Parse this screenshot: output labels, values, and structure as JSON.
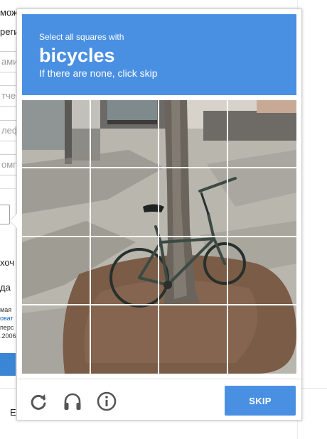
{
  "background": {
    "snippets": [
      "мож",
      "реги",
      "амил",
      "тчес",
      "леф",
      "омпа",
      "хоч",
      "да",
      "мая",
      "оват",
      "перс",
      ".2006",
      "Е"
    ]
  },
  "captcha": {
    "instruction": "Select all squares with",
    "keyword": "bicycles",
    "hint": "If there are none, click skip",
    "skip_label": "SKIP",
    "icons": [
      "reload-icon",
      "audio-icon",
      "info-icon"
    ],
    "colors": {
      "accent": "#4a90e2",
      "header_text": "#ffffff",
      "icon": "#555555"
    }
  }
}
